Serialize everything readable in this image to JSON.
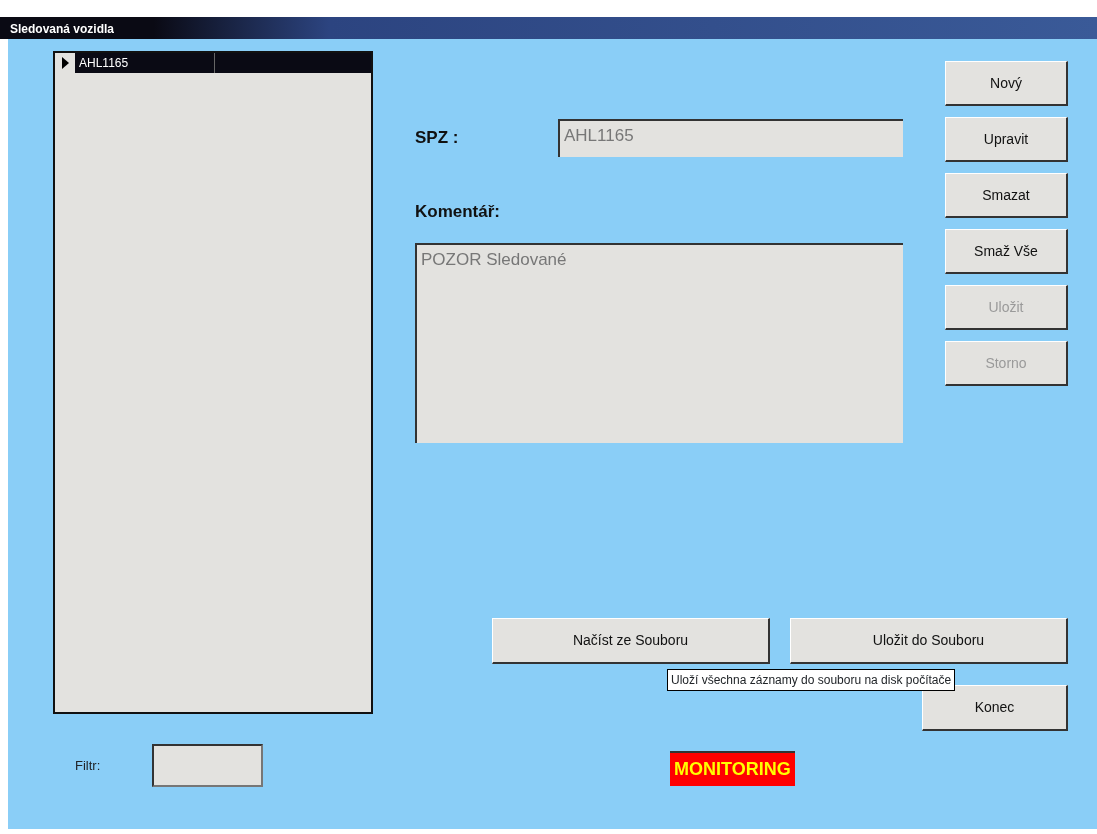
{
  "window": {
    "title": "Sledovaná vozidla"
  },
  "list": {
    "rows": [
      {
        "text": "AHL1165",
        "selected": true
      }
    ]
  },
  "spz": {
    "label": "SPZ :",
    "value": "AHL1165"
  },
  "comment": {
    "label": "Komentář:",
    "value": "POZOR Sledované"
  },
  "side_buttons": [
    {
      "label": "Nový",
      "disabled": false
    },
    {
      "label": "Upravit",
      "disabled": false
    },
    {
      "label": "Smazat",
      "disabled": false
    },
    {
      "label": "Smaž Vše",
      "disabled": false
    },
    {
      "label": "Uložit",
      "disabled": true
    },
    {
      "label": "Storno",
      "disabled": true
    }
  ],
  "file_buttons": [
    {
      "label": "Načíst ze Souboru",
      "disabled": false
    },
    {
      "label": "Uložit do Souboru",
      "disabled": false
    }
  ],
  "tooltip": "Uloží všechna záznamy do souboru na disk počítače",
  "exit_button": {
    "label": "Konec",
    "disabled": false
  },
  "filter": {
    "label": "Filtr:"
  },
  "status_badge": "MONITORING"
}
